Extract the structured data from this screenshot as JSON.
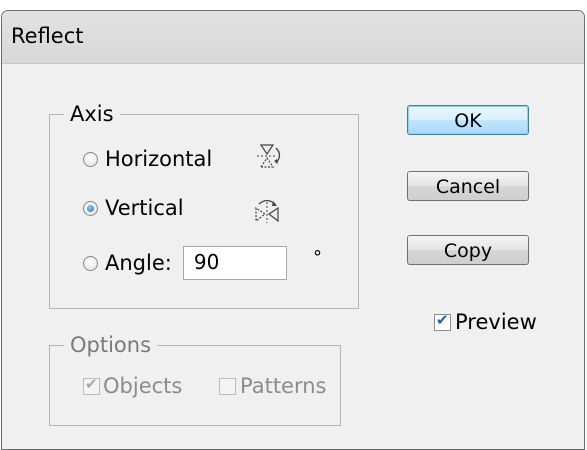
{
  "window": {
    "title": "Reflect"
  },
  "axis": {
    "legend": "Axis",
    "options": [
      {
        "label": "Horizontal",
        "checked": false,
        "icon": "reflect-horizontal-icon"
      },
      {
        "label": "Vertical",
        "checked": true,
        "icon": "reflect-vertical-icon"
      },
      {
        "label": "Angle:",
        "checked": false
      }
    ],
    "angle_value": "90",
    "degree_symbol": "°"
  },
  "options": {
    "legend": "Options",
    "objects": {
      "label": "Objects",
      "checked": true,
      "enabled": false
    },
    "patterns": {
      "label": "Patterns",
      "checked": false,
      "enabled": false
    }
  },
  "buttons": {
    "ok": "OK",
    "cancel": "Cancel",
    "copy": "Copy"
  },
  "preview": {
    "label": "Preview",
    "checked": true
  },
  "colors": {
    "default_button_border": "#3c7fb1",
    "radio_fill": "#1a6fc2",
    "check": "#2b5fab"
  }
}
